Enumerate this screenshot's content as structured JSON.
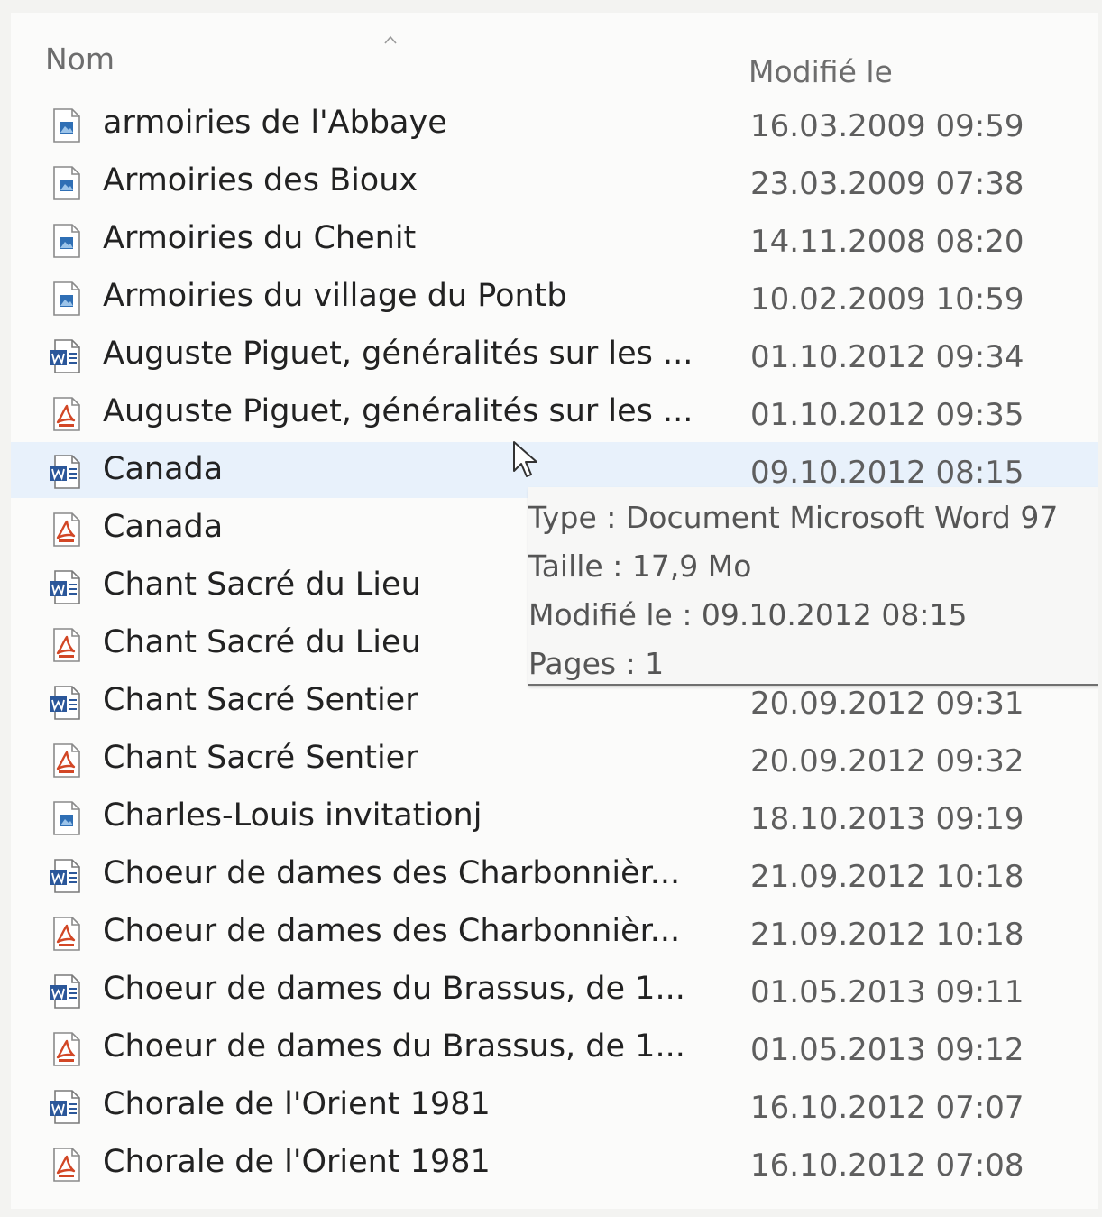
{
  "columns": {
    "name": "Nom",
    "modified": "Modifié le"
  },
  "files": [
    {
      "name": "armoiries de l'Abbaye",
      "modified": "16.03.2009 09:59",
      "icon": "image-file-icon"
    },
    {
      "name": "Armoiries des Bioux",
      "modified": "23.03.2009 07:38",
      "icon": "image-file-icon"
    },
    {
      "name": "Armoiries du Chenit",
      "modified": "14.11.2008 08:20",
      "icon": "image-file-icon"
    },
    {
      "name": "Armoiries du village du Pontb",
      "modified": "10.02.2009 10:59",
      "icon": "image-file-icon"
    },
    {
      "name": "Auguste Piguet, généralités sur les ...",
      "modified": "01.10.2012 09:34",
      "icon": "word-file-icon"
    },
    {
      "name": "Auguste Piguet, généralités sur les ...",
      "modified": "01.10.2012 09:35",
      "icon": "pdf-file-icon"
    },
    {
      "name": "Canada",
      "modified": "09.10.2012 08:15",
      "icon": "word-file-icon"
    },
    {
      "name": "Canada",
      "modified": "",
      "icon": "pdf-file-icon"
    },
    {
      "name": "Chant Sacré du Lieu",
      "modified": "",
      "icon": "word-file-icon"
    },
    {
      "name": "Chant Sacré du Lieu",
      "modified": "",
      "icon": "pdf-file-icon"
    },
    {
      "name": "Chant Sacré Sentier",
      "modified": "20.09.2012 09:31",
      "icon": "word-file-icon"
    },
    {
      "name": "Chant Sacré Sentier",
      "modified": "20.09.2012 09:32",
      "icon": "pdf-file-icon"
    },
    {
      "name": "Charles-Louis invitationj",
      "modified": "18.10.2013 09:19",
      "icon": "image-file-icon"
    },
    {
      "name": "Choeur de dames des Charbonnièr...",
      "modified": "21.09.2012 10:18",
      "icon": "word-file-icon"
    },
    {
      "name": "Choeur de dames des Charbonnièr...",
      "modified": "21.09.2012 10:18",
      "icon": "pdf-file-icon"
    },
    {
      "name": "Choeur de dames du Brassus, de 1...",
      "modified": "01.05.2013 09:11",
      "icon": "word-file-icon"
    },
    {
      "name": "Choeur de dames du Brassus, de 1...",
      "modified": "01.05.2013 09:12",
      "icon": "pdf-file-icon"
    },
    {
      "name": "Chorale de l'Orient 1981",
      "modified": "16.10.2012 07:07",
      "icon": "word-file-icon"
    },
    {
      "name": "Chorale de l'Orient 1981",
      "modified": "16.10.2012 07:08",
      "icon": "pdf-file-icon"
    }
  ],
  "hovered_row": 6,
  "tooltip": {
    "type_line": "Type : Document Microsoft Word 97",
    "size_line": "Taille : 17,9 Mo",
    "modified_line": "Modifié le : 09.10.2012 08:15",
    "pages_line": "Pages : 1"
  },
  "colors": {
    "word_blue": "#2b579a",
    "pdf_red": "#d24726",
    "image_blue": "#2f6fb5",
    "hover": "#e8f1fb"
  }
}
